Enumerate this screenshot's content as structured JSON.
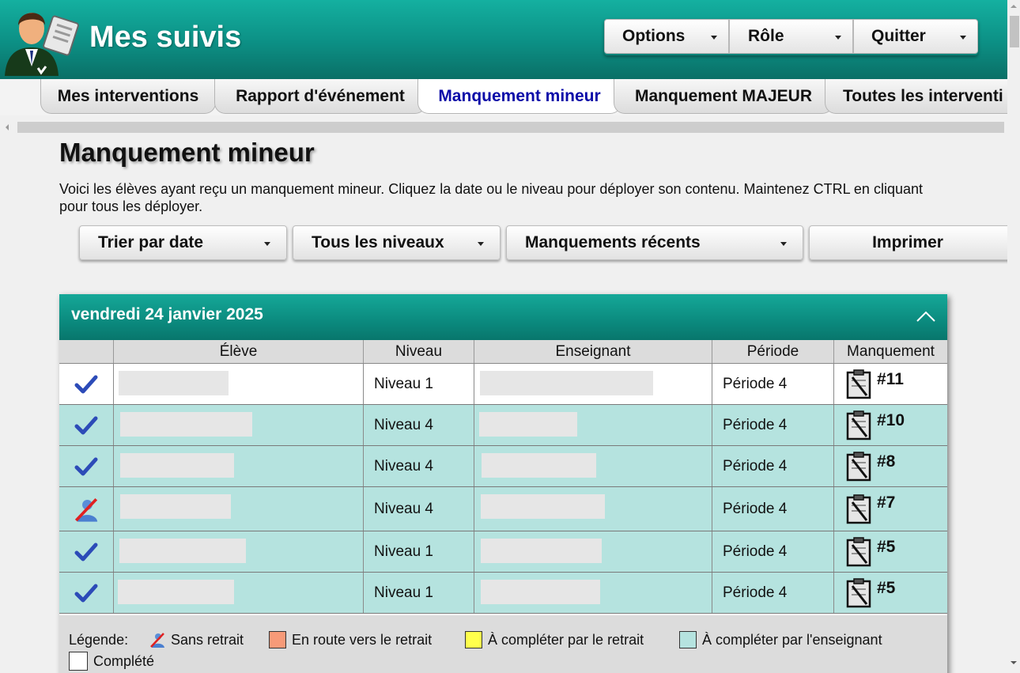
{
  "header": {
    "app_title": "Mes suivis",
    "menu": [
      {
        "label": "Options"
      },
      {
        "label": "Rôle"
      },
      {
        "label": "Quitter"
      }
    ]
  },
  "tabs": [
    {
      "label": "Mes interventions",
      "active": false
    },
    {
      "label": "Rapport d'événement",
      "active": false
    },
    {
      "label": "Manquement mineur",
      "active": true
    },
    {
      "label": "Manquement MAJEUR",
      "active": false
    },
    {
      "label": "Toutes les interventi",
      "active": false
    }
  ],
  "page": {
    "title": "Manquement mineur",
    "intro": "Voici les élèves ayant reçu un manquement mineur. Cliquez la date ou le niveau pour déployer son contenu. Maintenez CTRL en cliquant pour tous les déployer."
  },
  "filters": {
    "sort": "Trier par date",
    "levels": "Tous les niveaux",
    "range": "Manquements récents",
    "print": "Imprimer"
  },
  "group": {
    "date": "vendredi 24 janvier 2025",
    "columns": {
      "eleve": "Élève",
      "niveau": "Niveau",
      "enseignant": "Enseignant",
      "periode": "Période",
      "manquement": "Manquement"
    },
    "rows": [
      {
        "status": "complete",
        "niveau": "Niveau 1",
        "periode": "Période 4",
        "manquement": "#11"
      },
      {
        "status": "enseignant",
        "niveau": "Niveau 4",
        "periode": "Période 4",
        "manquement": "#10"
      },
      {
        "status": "enseignant",
        "niveau": "Niveau 4",
        "periode": "Période 4",
        "manquement": "#8"
      },
      {
        "status": "sans-retrait",
        "niveau": "Niveau 4",
        "periode": "Période 4",
        "manquement": "#7"
      },
      {
        "status": "enseignant",
        "niveau": "Niveau 1",
        "periode": "Période 4",
        "manquement": "#5"
      },
      {
        "status": "enseignant",
        "niveau": "Niveau 1",
        "periode": "Période 4",
        "manquement": "#5"
      }
    ]
  },
  "legend": {
    "title": "Légende:",
    "sans_retrait": "Sans retrait",
    "en_route": "En route vers le retrait",
    "a_completer_retrait": "À compléter par le retrait",
    "a_completer_enseignant": "À compléter par l'enseignant",
    "complete": "Complété"
  },
  "colors": {
    "teal_row": "#b5e3df",
    "en_route": "#f79a78",
    "a_completer_retrait": "#ffff4d",
    "a_completer_enseignant": "#b5e3df",
    "complete": "#ffffff",
    "check": "#2c4bb8"
  }
}
